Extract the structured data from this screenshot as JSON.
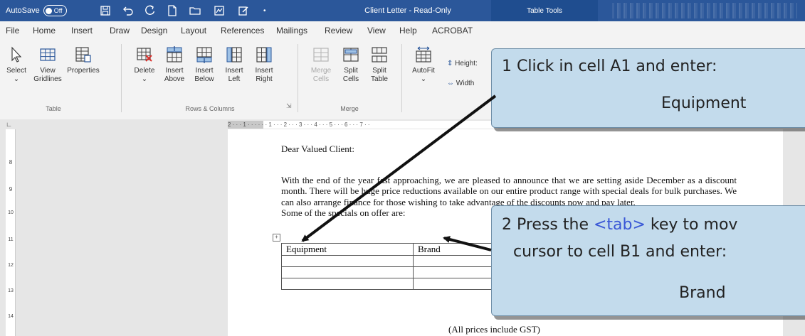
{
  "titlebar": {
    "autosave_label": "AutoSave",
    "autosave_state": "Off",
    "title": "Client Letter  -  Read-Only",
    "table_tools": "Table Tools",
    "bar_color": "#2b579a"
  },
  "menu": {
    "tabs": [
      "File",
      "Home",
      "Insert",
      "Draw",
      "Design",
      "Layout",
      "References",
      "Mailings",
      "Review",
      "View",
      "Help",
      "ACROBAT"
    ]
  },
  "ribbon": {
    "buttons": {
      "select": "Select",
      "view_gridlines_1": "View",
      "view_gridlines_2": "Gridlines",
      "properties": "Properties",
      "delete": "Delete",
      "insert_above_1": "Insert",
      "insert_above_2": "Above",
      "insert_below_1": "Insert",
      "insert_below_2": "Below",
      "insert_left_1": "Insert",
      "insert_left_2": "Left",
      "insert_right_1": "Insert",
      "insert_right_2": "Right",
      "merge_cells_1": "Merge",
      "merge_cells_2": "Cells",
      "split_cells_1": "Split",
      "split_cells_2": "Cells",
      "split_table_1": "Split",
      "split_table_2": "Table",
      "autofit": "AutoFit",
      "height": "Height:",
      "width": "Width"
    },
    "groups": {
      "table": "Table",
      "rows_columns": "Rows & Columns",
      "merge": "Merge"
    }
  },
  "ruler": {
    "h_text": "2 · · · 1 · · ·  · · · 1 · · · 2 · · · 3 · · · 4 · · · 5 · · · 6 · · · 7 · ·",
    "v_numbers": [
      "8",
      "9",
      "10",
      "11",
      "12",
      "13",
      "14"
    ]
  },
  "document": {
    "salutation": "Dear Valued Client:",
    "paragraph": "With the end of the year fast approaching, we are pleased to announce that we are setting aside December as a discount month.  There will be huge price reductions available on our entire product range with special deals for bulk purchases.  We can also arrange finance for those wishing to take advantage of the discounts now and pay later.",
    "specials": "Some of the specials on offer are:",
    "table": {
      "rows": [
        [
          "Equipment",
          "Brand",
          ""
        ],
        [
          "",
          "",
          ""
        ],
        [
          "",
          "",
          ""
        ],
        [
          "",
          "",
          ""
        ]
      ]
    },
    "footnote": "(All prices include GST)"
  },
  "callouts": {
    "one": {
      "line1": "1  Click in cell A1 and enter:",
      "line2": "Equipment"
    },
    "two": {
      "line1_pre": "2  Press the ",
      "line1_key": "<tab>",
      "line1_post": " key to mov",
      "line2": "cursor to cell B1 and enter:",
      "line3": "Brand"
    },
    "fill_color": "#c3dbec",
    "key_color": "#3957d6"
  }
}
